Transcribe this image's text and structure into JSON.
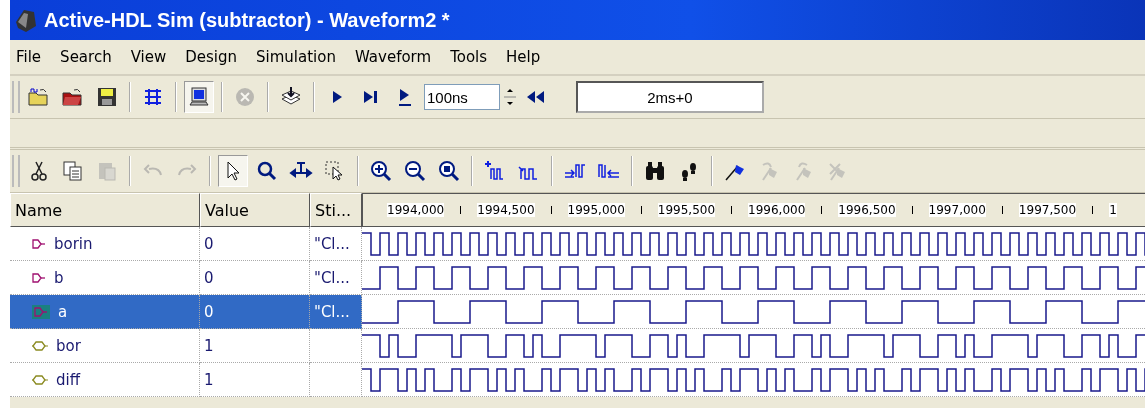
{
  "window": {
    "title": "Active-HDL Sim (subtractor) - Waveform2 *"
  },
  "menu": [
    "File",
    "Search",
    "View",
    "Design",
    "Simulation",
    "Waveform",
    "Tools",
    "Help"
  ],
  "toolbar_1": [
    {
      "kind": "new-folder",
      "disabled": false
    },
    {
      "kind": "open-folder",
      "disabled": false
    },
    {
      "kind": "save",
      "disabled": false
    },
    {
      "kind": "sep"
    },
    {
      "kind": "structure",
      "disabled": false
    },
    {
      "kind": "sep"
    },
    {
      "kind": "monitor",
      "disabled": false,
      "pressed": true
    },
    {
      "kind": "sep"
    },
    {
      "kind": "stop",
      "disabled": true
    },
    {
      "kind": "sep"
    },
    {
      "kind": "stack",
      "disabled": false
    },
    {
      "kind": "sep"
    },
    {
      "kind": "play",
      "disabled": false
    },
    {
      "kind": "step",
      "disabled": false
    },
    {
      "kind": "play-for",
      "disabled": false
    },
    {
      "kind": "field",
      "value": "100ns"
    },
    {
      "kind": "spin"
    },
    {
      "kind": "rewind",
      "disabled": false
    },
    {
      "kind": "time",
      "value": "2ms+0"
    }
  ],
  "toolbar_2": [
    {
      "kind": "cut",
      "disabled": false
    },
    {
      "kind": "copy",
      "disabled": false
    },
    {
      "kind": "paste",
      "disabled": true
    },
    {
      "kind": "sep"
    },
    {
      "kind": "undo",
      "disabled": true
    },
    {
      "kind": "redo",
      "disabled": true
    },
    {
      "kind": "sep"
    },
    {
      "kind": "pointer",
      "disabled": false,
      "pressed": true
    },
    {
      "kind": "zoom",
      "disabled": false
    },
    {
      "kind": "measure",
      "disabled": false
    },
    {
      "kind": "zoom-area",
      "disabled": false
    },
    {
      "kind": "sep"
    },
    {
      "kind": "zoom-in",
      "disabled": false
    },
    {
      "kind": "zoom-out",
      "disabled": false
    },
    {
      "kind": "zoom-fit",
      "disabled": false
    },
    {
      "kind": "sep"
    },
    {
      "kind": "wave-add",
      "disabled": false
    },
    {
      "kind": "wave-edge",
      "disabled": false
    },
    {
      "kind": "sep"
    },
    {
      "kind": "shift-right",
      "disabled": false
    },
    {
      "kind": "shift-left",
      "disabled": false
    },
    {
      "kind": "sep"
    },
    {
      "kind": "binoculars",
      "disabled": false
    },
    {
      "kind": "footprints",
      "disabled": false
    },
    {
      "kind": "sep"
    },
    {
      "kind": "flag",
      "disabled": false
    },
    {
      "kind": "flag-next",
      "disabled": true
    },
    {
      "kind": "flag-prev",
      "disabled": true
    },
    {
      "kind": "flag-clear",
      "disabled": true
    }
  ],
  "table": {
    "columns": [
      "Name",
      "Value",
      "Sti..."
    ],
    "ruler": [
      "1994,000",
      "1994,500",
      "1995,000",
      "1995,500",
      "1996,000",
      "1996,500",
      "1997,000",
      "1997,500",
      "1"
    ],
    "rows": [
      {
        "name": "borin",
        "kind": "input",
        "value": "0",
        "stimulus": "\"Cl...",
        "waveform": {
          "kind": "fast"
        },
        "selected": false
      },
      {
        "name": "b",
        "kind": "input",
        "value": "0",
        "stimulus": "\"Cl...",
        "waveform": {
          "kind": "medium"
        },
        "selected": false
      },
      {
        "name": "a",
        "kind": "input",
        "value": "0",
        "stimulus": "\"Cl...",
        "waveform": {
          "kind": "slow"
        },
        "selected": true
      },
      {
        "name": "bor",
        "kind": "output",
        "value": "1",
        "waveform": {
          "kind": "irregular"
        },
        "selected": false
      },
      {
        "name": "diff",
        "kind": "output",
        "value": "1",
        "waveform": {
          "kind": "mixed"
        },
        "selected": false
      }
    ]
  }
}
